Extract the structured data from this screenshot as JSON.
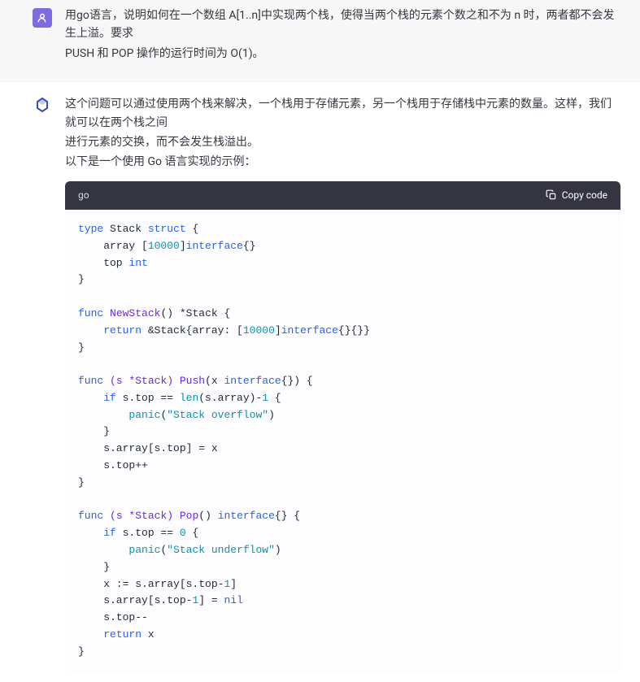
{
  "user_message": {
    "line1": "用go语言，说明如何在一个数组 A[1..n]中实现两个栈，使得当两个栈的元素个数之和不为 n 时，两者都不会发生上溢。要求PUSH 和 POP 操作的运行时间为 O(1)。",
    "line1a": "用go语言，说明如何在一个数组 A[1..n]中实现两个栈，使得当两个栈的元素个数之和不为 n 时，两者都不会发生上溢。要求",
    "line1b": "PUSH 和 POP 操作的运行时间为 O(1)。"
  },
  "assistant_message": {
    "p1a": "这个问题可以通过使用两个栈来解决，一个栈用于存储元素，另一个栈用于存储栈中元素的数量。这样，我们就可以在两个栈之间",
    "p1b": "进行元素的交换，而不会发生栈溢出。",
    "p2": "以下是一个使用 Go 语言实现的示例："
  },
  "code_block": {
    "language": "go",
    "copy_label": "Copy code",
    "lines": {
      "l01a": "type",
      "l01b": " Stack ",
      "l01c": "struct",
      "l01d": " {",
      "l02a": "    array [",
      "l02b": "10000",
      "l02c": "]",
      "l02d": "interface",
      "l02e": "{}",
      "l03a": "    top ",
      "l03b": "int",
      "l04": "}",
      "l05": "",
      "l06a": "func",
      "l06b": " ",
      "l06c": "NewStack",
      "l06d": "()",
      "l06e": " *Stack {",
      "l07a": "    ",
      "l07b": "return",
      "l07c": " &Stack{array: [",
      "l07d": "10000",
      "l07e": "]",
      "l07f": "interface",
      "l07g": "{}{}}",
      "l08": "}",
      "l09": "",
      "l10a": "func",
      "l10b": " ",
      "l10c": "(s *Stack)",
      "l10d": " ",
      "l10e": "Push",
      "l10f": "(x ",
      "l10g": "interface",
      "l10h": "{})",
      "l10i": " {",
      "l11a": "    ",
      "l11b": "if",
      "l11c": " s.top == ",
      "l11d": "len",
      "l11e": "(s.array)-",
      "l11f": "1",
      "l11g": " {",
      "l12a": "        ",
      "l12b": "panic",
      "l12c": "(",
      "l12d": "\"Stack overflow\"",
      "l12e": ")",
      "l13": "    }",
      "l14": "    s.array[s.top] = x",
      "l15": "    s.top++",
      "l16": "}",
      "l17": "",
      "l18a": "func",
      "l18b": " ",
      "l18c": "(s *Stack)",
      "l18d": " ",
      "l18e": "Pop",
      "l18f": "()",
      "l18g": " ",
      "l18h": "interface",
      "l18i": "{} {",
      "l19a": "    ",
      "l19b": "if",
      "l19c": " s.top == ",
      "l19d": "0",
      "l19e": " {",
      "l20a": "        ",
      "l20b": "panic",
      "l20c": "(",
      "l20d": "\"Stack underflow\"",
      "l20e": ")",
      "l21": "    }",
      "l22a": "    x := s.array[s.top-",
      "l22b": "1",
      "l22c": "]",
      "l23a": "    s.array[s.top-",
      "l23b": "1",
      "l23c": "] = ",
      "l23d": "nil",
      "l24": "    s.top--",
      "l25a": "    ",
      "l25b": "return",
      "l25c": " x",
      "l26": "}"
    }
  }
}
